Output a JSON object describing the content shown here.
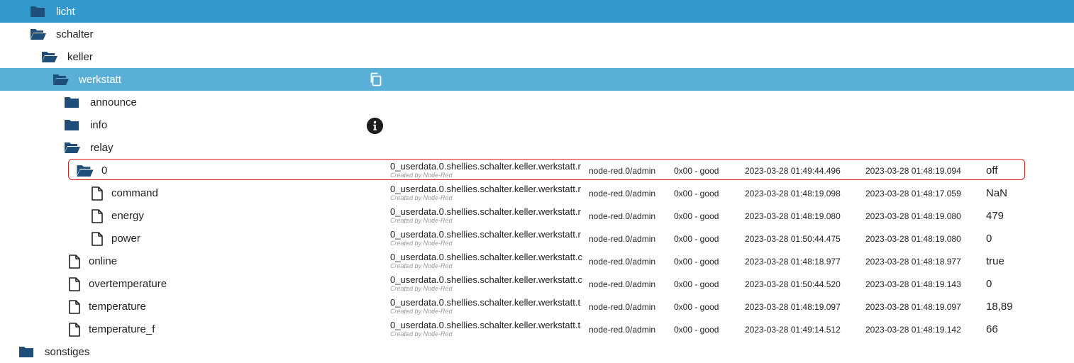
{
  "colors": {
    "selected_dark": "#3399cc",
    "selected_light": "#5aafd6",
    "folder": "#1f4e79",
    "highlight_border": "#e0201c"
  },
  "rows": [
    {
      "name": "licht",
      "icon": "folder-closed-icon",
      "id": "licht"
    },
    {
      "name": "schalter",
      "icon": "folder-open-icon",
      "id": ""
    },
    {
      "name": "keller",
      "icon": "folder-open-icon",
      "id": ""
    },
    {
      "name": "werkstatt",
      "icon": "folder-open-icon",
      "id": ""
    },
    {
      "name": "announce",
      "icon": "folder-closed-icon",
      "id": "announce"
    },
    {
      "name": "info",
      "icon": "folder-closed-icon",
      "id": "info"
    },
    {
      "name": "relay",
      "icon": "folder-open-icon",
      "id": "relay"
    },
    {
      "name": "0",
      "icon": "folder-open-icon",
      "id": "0_userdata.0.shellies.schalter.keller.werkstatt.r",
      "desc": "Created by Node-Red",
      "from": "node-red.0/admin",
      "quality": "0x00 - good",
      "ts": "2023-03-28 01:49:44.496",
      "lc": "2023-03-28 01:48:19.094",
      "value": "off"
    },
    {
      "name": "command",
      "icon": "file-icon",
      "id": "0_userdata.0.shellies.schalter.keller.werkstatt.r",
      "desc": "Created by Node-Red",
      "from": "node-red.0/admin",
      "quality": "0x00 - good",
      "ts": "2023-03-28 01:48:19.098",
      "lc": "2023-03-28 01:48:17.059",
      "value": "NaN"
    },
    {
      "name": "energy",
      "icon": "file-icon",
      "id": "0_userdata.0.shellies.schalter.keller.werkstatt.r",
      "desc": "Created by Node-Red",
      "from": "node-red.0/admin",
      "quality": "0x00 - good",
      "ts": "2023-03-28 01:48:19.080",
      "lc": "2023-03-28 01:48:19.080",
      "value": "479"
    },
    {
      "name": "power",
      "icon": "file-icon",
      "id": "0_userdata.0.shellies.schalter.keller.werkstatt.r",
      "desc": "Created by Node-Red",
      "from": "node-red.0/admin",
      "quality": "0x00 - good",
      "ts": "2023-03-28 01:50:44.475",
      "lc": "2023-03-28 01:48:19.080",
      "value": "0"
    },
    {
      "name": "online",
      "icon": "file-icon",
      "id": "0_userdata.0.shellies.schalter.keller.werkstatt.c",
      "desc": "Created by Node-Red",
      "from": "node-red.0/admin",
      "quality": "0x00 - good",
      "ts": "2023-03-28 01:48:18.977",
      "lc": "2023-03-28 01:48:18.977",
      "value": "true"
    },
    {
      "name": "overtemperature",
      "icon": "file-icon",
      "id": "0_userdata.0.shellies.schalter.keller.werkstatt.c",
      "desc": "Created by Node-Red",
      "from": "node-red.0/admin",
      "quality": "0x00 - good",
      "ts": "2023-03-28 01:50:44.520",
      "lc": "2023-03-28 01:48:19.143",
      "value": "0"
    },
    {
      "name": "temperature",
      "icon": "file-icon",
      "id": "0_userdata.0.shellies.schalter.keller.werkstatt.t",
      "desc": "Created by Node-Red",
      "from": "node-red.0/admin",
      "quality": "0x00 - good",
      "ts": "2023-03-28 01:48:19.097",
      "lc": "2023-03-28 01:48:19.097",
      "value": "18,89"
    },
    {
      "name": "temperature_f",
      "icon": "file-icon",
      "id": "0_userdata.0.shellies.schalter.keller.werkstatt.t",
      "desc": "Created by Node-Red",
      "from": "node-red.0/admin",
      "quality": "0x00 - good",
      "ts": "2023-03-28 01:49:14.512",
      "lc": "2023-03-28 01:48:19.142",
      "value": "66"
    },
    {
      "name": "sonstiges",
      "icon": "folder-closed-icon",
      "id": "sonstiges"
    }
  ],
  "actions": {
    "copy_icon": "copy-icon",
    "info_icon": "info-icon"
  }
}
